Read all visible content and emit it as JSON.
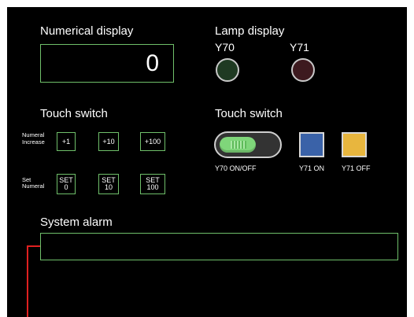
{
  "numerical_display": {
    "title": "Numerical display",
    "value": "0"
  },
  "lamp_display": {
    "title": "Lamp display",
    "lamps": [
      {
        "label": "Y70",
        "color": "#1f3a22"
      },
      {
        "label": "Y71",
        "color": "#3d1a1f"
      }
    ]
  },
  "touch_switch_left": {
    "title": "Touch switch",
    "rows": [
      {
        "label_line1": "Numeral",
        "label_line2": "Increase",
        "buttons": [
          {
            "label": "+1"
          },
          {
            "label": "+10"
          },
          {
            "label": "+100"
          }
        ]
      },
      {
        "label_line1": "Set",
        "label_line2": "Numeral",
        "buttons": [
          {
            "line1": "SET",
            "line2": "0"
          },
          {
            "line1": "SET",
            "line2": "10"
          },
          {
            "line1": "SET",
            "line2": "100"
          }
        ]
      }
    ]
  },
  "touch_switch_right": {
    "title": "Touch switch",
    "toggle": {
      "label": "Y70 ON/OFF",
      "color": "#7fd67a"
    },
    "y71_on": {
      "label": "Y71 ON",
      "color": "#3a62a8"
    },
    "y71_off": {
      "label": "Y71 OFF",
      "color": "#e8b63e"
    }
  },
  "system_alarm": {
    "title": "System alarm",
    "text": ""
  },
  "colors": {
    "background": "#000000",
    "frame": "#6fbf6a",
    "marker": "#e02020"
  }
}
